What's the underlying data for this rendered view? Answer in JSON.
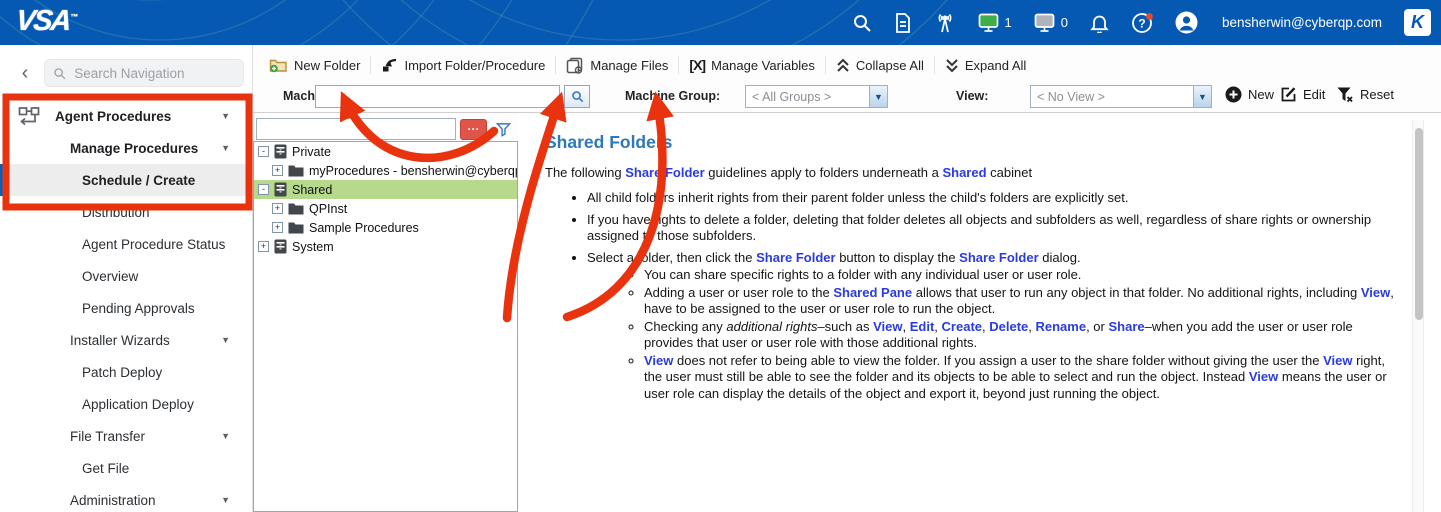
{
  "topbar": {
    "logo": "VSA",
    "logo_tm": "™",
    "online_count": "1",
    "offline_count": "0",
    "user_email": "bensherwin@cyberqp.com",
    "k_glyph": "K"
  },
  "sidebar": {
    "back_glyph": "‹",
    "search_placeholder": "Search Navigation",
    "items": [
      {
        "label": "Agent Procedures",
        "level": 1,
        "bold": true,
        "chevron": true,
        "icon": "workflow"
      },
      {
        "label": "Manage Procedures",
        "level": 2,
        "bold": true,
        "chevron": true
      },
      {
        "label": "Schedule / Create",
        "level": 3,
        "bold": true,
        "active": true
      },
      {
        "label": "Distribution",
        "level": 3
      },
      {
        "label": "Agent Procedure Status",
        "level": 3
      },
      {
        "label": "Overview",
        "level": 3
      },
      {
        "label": "Pending Approvals",
        "level": 3
      },
      {
        "label": "Installer Wizards",
        "level": 2,
        "chevron": true
      },
      {
        "label": "Patch Deploy",
        "level": 3
      },
      {
        "label": "Application Deploy",
        "level": 3
      },
      {
        "label": "File Transfer",
        "level": 2,
        "chevron": true
      },
      {
        "label": "Get File",
        "level": 3
      },
      {
        "label": "Administration",
        "level": 2,
        "chevron": true
      }
    ]
  },
  "toolbar": {
    "buttons": [
      "New Folder",
      "Import Folder/Procedure",
      "Manage Files",
      "Manage Variables",
      "Collapse All",
      "Expand All"
    ],
    "variables_glyph": "[X]",
    "machine_id_label": "Machine Id:",
    "machine_group_label": "Machine Group:",
    "machine_group_value": "< All Groups >",
    "view_label": "View:",
    "view_value": "< No View >",
    "view_buttons": [
      "New",
      "Edit",
      "Reset"
    ],
    "dots_glyph": "···"
  },
  "tree": {
    "items": [
      {
        "label": "Private",
        "type": "cabinet",
        "exp": "-",
        "level": 1
      },
      {
        "label": "myProcedures - bensherwin@cyberqp.com",
        "type": "folder",
        "exp": "+",
        "level": 2
      },
      {
        "label": "Shared",
        "type": "cabinet",
        "exp": "-",
        "level": 1,
        "selected": true
      },
      {
        "label": "QPInst",
        "type": "folder",
        "exp": "+",
        "level": 2
      },
      {
        "label": "Sample Procedures",
        "type": "folder",
        "exp": "+",
        "level": 2
      },
      {
        "label": "System",
        "type": "cabinet",
        "exp": "+",
        "level": 1
      }
    ]
  },
  "content": {
    "title": "Shared Folders",
    "intro": [
      {
        "t": "The following "
      },
      {
        "t": "Share Folder",
        "s": "link"
      },
      {
        "t": " guidelines apply to folders underneath a "
      },
      {
        "t": "Shared",
        "s": "link"
      },
      {
        "t": " cabinet"
      }
    ],
    "bullets": [
      {
        "level": 1,
        "segs": [
          {
            "t": "All child folders inherit rights from their parent folder unless the child's folders are explicitly set."
          }
        ]
      },
      {
        "level": 1,
        "segs": [
          {
            "t": "If you have rights to delete a folder, deleting that folder deletes all objects and subfolders as well, regardless of share rights or ownership assigned to those subfolders."
          }
        ]
      },
      {
        "level": 1,
        "segs": [
          {
            "t": "Select a folder, then click the "
          },
          {
            "t": "Share Folder",
            "s": "link"
          },
          {
            "t": " button to display the "
          },
          {
            "t": "Share Folder",
            "s": "link"
          },
          {
            "t": " dialog."
          }
        ]
      },
      {
        "level": 2,
        "segs": [
          {
            "t": "You can share specific rights to a folder with any individual user or user role."
          }
        ]
      },
      {
        "level": 2,
        "segs": [
          {
            "t": "Adding a user or user role to the "
          },
          {
            "t": "Shared Pane",
            "s": "link"
          },
          {
            "t": " allows that user to run any object in that folder. No additional rights, including "
          },
          {
            "t": "View",
            "s": "link"
          },
          {
            "t": ", have to be assigned to the user or user role to run the object."
          }
        ]
      },
      {
        "level": 2,
        "segs": [
          {
            "t": "Checking any "
          },
          {
            "t": "additional rights",
            "s": "em"
          },
          {
            "t": "–such as "
          },
          {
            "t": "View",
            "s": "link"
          },
          {
            "t": ", "
          },
          {
            "t": "Edit",
            "s": "link"
          },
          {
            "t": ", "
          },
          {
            "t": "Create",
            "s": "link"
          },
          {
            "t": ", "
          },
          {
            "t": "Delete",
            "s": "link"
          },
          {
            "t": ", "
          },
          {
            "t": "Rename",
            "s": "link"
          },
          {
            "t": ", or "
          },
          {
            "t": "Share",
            "s": "link"
          },
          {
            "t": "–when you add the user or user role provides that user or user role with those additional rights."
          }
        ]
      },
      {
        "level": 2,
        "segs": [
          {
            "t": "View",
            "s": "link"
          },
          {
            "t": " does not refer to being able to view the folder. If you assign a user to the share folder without giving the user the "
          },
          {
            "t": "View",
            "s": "link"
          },
          {
            "t": " right, the user must still be able to see the folder and its objects to be able to select and run the object. Instead "
          },
          {
            "t": "View",
            "s": "link"
          },
          {
            "t": " means the user or user role can display the details of the object and export it, beyond just running the object."
          }
        ]
      }
    ]
  }
}
